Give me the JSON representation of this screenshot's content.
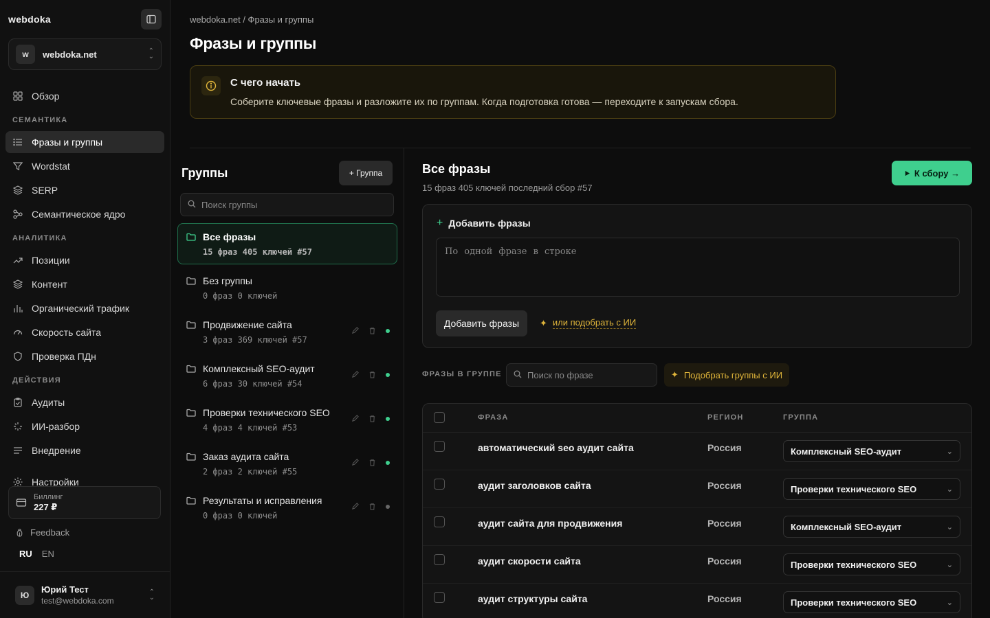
{
  "sidebar": {
    "brand": "webdoka",
    "site": {
      "avatar": "w",
      "name": "webdoka.net"
    },
    "overview": "Обзор",
    "sections": {
      "semantics": "СЕМАНТИКА",
      "analytics": "АНАЛИТИКА",
      "actions": "ДЕЙСТВИЯ"
    },
    "items": {
      "phrases": "Фразы и группы",
      "wordstat": "Wordstat",
      "serp": "SERP",
      "core": "Семантическое ядро",
      "positions": "Позиции",
      "content": "Контент",
      "traffic": "Органический трафик",
      "speed": "Скорость сайта",
      "pdn": "Проверка ПДн",
      "audits": "Аудиты",
      "ai": "ИИ-разбор",
      "implementation": "Внедрение",
      "settings": "Настройки"
    },
    "billing": {
      "label": "Биллинг",
      "value": "227 ₽"
    },
    "feedback": "Feedback",
    "langs": {
      "ru": "RU",
      "en": "EN"
    },
    "user": {
      "avatar": "Ю",
      "name": "Юрий Тест",
      "email": "test@webdoka.com"
    }
  },
  "header": {
    "breadcrumb": "webdoka.net / Фразы и группы",
    "title": "Фразы и группы"
  },
  "hint": {
    "title": "С чего начать",
    "text": "Соберите ключевые фразы и разложите их по группам. Когда подготовка готова — переходите к запускам сбора."
  },
  "groups": {
    "title": "Группы",
    "add_label": "+ Группа",
    "search_placeholder": "Поиск группы",
    "items": [
      {
        "name": "Все фразы",
        "meta": "15 фраз 405 ключей #57"
      },
      {
        "name": "Без группы",
        "meta": "0 фраз 0 ключей"
      },
      {
        "name": "Продвижение сайта",
        "meta": "3 фраз 369 ключей #57"
      },
      {
        "name": "Комплексный SEO-аудит",
        "meta": "6 фраз 30 ключей #54"
      },
      {
        "name": "Проверки технического SEO",
        "meta": "4 фраз 4 ключей #53"
      },
      {
        "name": "Заказ аудита сайта",
        "meta": "2 фраз 2 ключей #55"
      },
      {
        "name": "Результаты и исправления",
        "meta": "0 фраз 0 ключей"
      }
    ],
    "status_colors": {
      "active": "#3fcf8e",
      "empty": "#666666"
    }
  },
  "phrases": {
    "title": "Все фразы",
    "subtitle": "15 фраз 405 ключей последний сбор #57",
    "run_label": "К сбору →",
    "add_card": {
      "title": "Добавить фразы",
      "placeholder": "По одной фразе в строке",
      "button": "Добавить фразы",
      "ai_link": "или подобрать с ИИ"
    },
    "in_group_label": "ФРАЗЫ В ГРУППЕ",
    "search_placeholder": "Поиск по фразе",
    "ai_groups_label": "Подобрать группы с ИИ",
    "table": {
      "headers": {
        "phrase": "ФРАЗА",
        "region": "РЕГИОН",
        "group": "ГРУППА"
      },
      "rows": [
        {
          "phrase": "автоматический seo аудит сайта",
          "region": "Россия",
          "group": "Комплексный SEO-аудит"
        },
        {
          "phrase": "аудит заголовков сайта",
          "region": "Россия",
          "group": "Проверки технического SEO"
        },
        {
          "phrase": "аудит сайта для продвижения",
          "region": "Россия",
          "group": "Комплексный SEO-аудит"
        },
        {
          "phrase": "аудит скорости сайта",
          "region": "Россия",
          "group": "Проверки технического SEO"
        },
        {
          "phrase": "аудит структуры сайта",
          "region": "Россия",
          "group": "Проверки технического SEO"
        }
      ]
    }
  },
  "colors": {
    "accent": "#3fcf8e",
    "warning": "#e0b53a"
  }
}
